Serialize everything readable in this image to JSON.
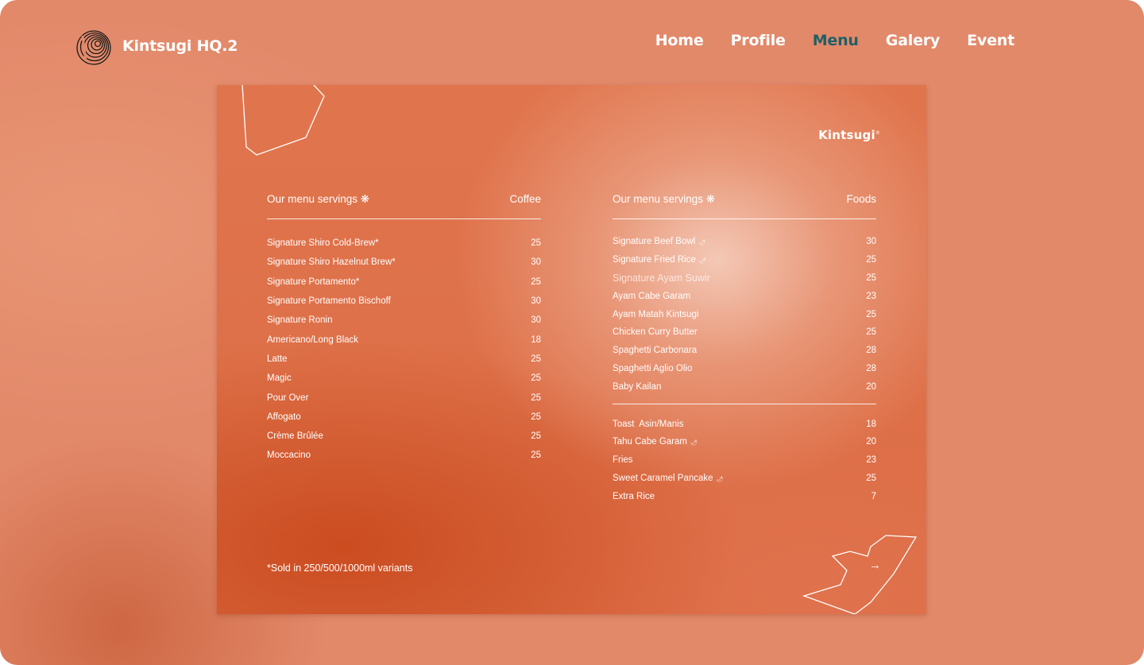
{
  "header": {
    "brand": "Kintsugi HQ.2",
    "nav": [
      {
        "label": "Home",
        "active": false
      },
      {
        "label": "Profile",
        "active": false
      },
      {
        "label": "Menu",
        "active": true
      },
      {
        "label": "Galery",
        "active": false
      },
      {
        "label": "Event",
        "active": false
      }
    ]
  },
  "card": {
    "logo": "Kintsugi",
    "logo_mark": "®",
    "coffee": {
      "heading": "Our menu servings ❋",
      "category": "Coffee",
      "items": [
        {
          "name": "Signature Shiro Cold-Brew*",
          "price": "25"
        },
        {
          "name": "Signature Shiro Hazelnut Brew*",
          "price": "30"
        },
        {
          "name": "Signature Portamento*",
          "price": "25"
        },
        {
          "name": "Signature Portamento Bischoff",
          "price": "30"
        },
        {
          "name": "Signature Ronin",
          "price": "30"
        },
        {
          "name": "Americano/Long Black",
          "price": "18"
        },
        {
          "name": "Latte",
          "price": "25"
        },
        {
          "name": "Magic",
          "price": "25"
        },
        {
          "name": "Pour Over",
          "price": "25"
        },
        {
          "name": "Affogato",
          "price": "25"
        },
        {
          "name": "Crème Brûlée",
          "price": "25"
        },
        {
          "name": "Moccacino",
          "price": "25"
        }
      ]
    },
    "foods": {
      "heading": "Our menu servings ❋",
      "category": "Foods",
      "items": [
        {
          "name": "Signature Beef Bowl",
          "price": "30",
          "icon": "🌶"
        },
        {
          "name": "Signature Fried Rice",
          "price": "25",
          "icon": "🌶"
        },
        {
          "name": "Signature Ayam Suwir",
          "price": "25"
        },
        {
          "name": "Ayam Cabe Garam",
          "price": "23"
        },
        {
          "name": "Ayam Matah Kintsugi",
          "price": "25"
        },
        {
          "name": "Chicken Curry Butter",
          "price": "25"
        },
        {
          "name": "Spaghetti Carbonara",
          "price": "28"
        },
        {
          "name": "Spaghetti Aglio Olio",
          "price": "28"
        },
        {
          "name": "Baby Kailan",
          "price": "20"
        }
      ],
      "snacks": [
        {
          "name": "Toast  Asin/Manis",
          "price": "18"
        },
        {
          "name": "Tahu Cabe Garam",
          "price": "20",
          "icon": "🌶"
        },
        {
          "name": "Fries",
          "price": "23"
        },
        {
          "name": "Sweet Caramel Pancake",
          "price": "25",
          "icon": "🌶"
        },
        {
          "name": "Extra Rice",
          "price": "7"
        }
      ]
    },
    "footnote": "*Sold in 250/500/1000ml variants",
    "next_arrow": "→"
  },
  "colors": {
    "background": "#e2896a",
    "nav_active": "#1f5f66",
    "text": "#ffffff"
  }
}
